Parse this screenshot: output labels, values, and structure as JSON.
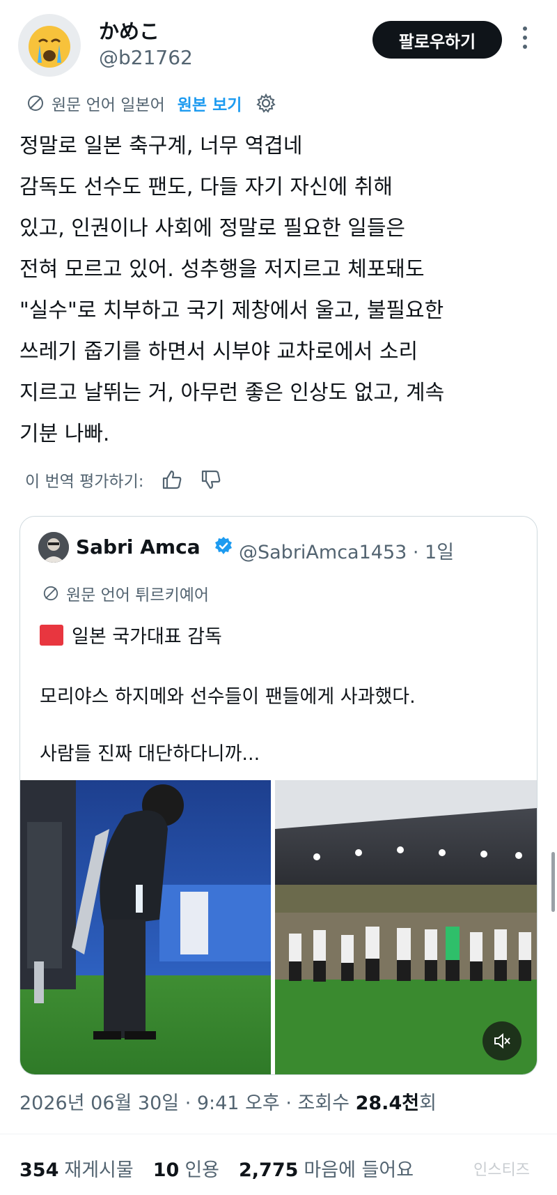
{
  "author": {
    "display_name": "かめこ",
    "handle": "@b21762",
    "avatar_icon": "crying-face-emoji-icon"
  },
  "follow_button": "팔로우하기",
  "translation": {
    "label": "원문 언어 일본어",
    "show_original": "원본 보기"
  },
  "body_lines": [
    "정말로 일본 축구계, 너무 역겹네",
    "감독도 선수도 팬도, 다들 자기 자신에 취해",
    "있고, 인권이나 사회에 정말로 필요한 일들은",
    "전혀 모르고 있어. 성추행을 저지르고 체포돼도",
    "\"실수\"로 치부하고 국기 제창에서 울고, 불필요한",
    "쓰레기 줍기를 하면서 시부야 교차로에서 소리",
    "지르고 날뛰는 거, 아무런 좋은 인상도 없고, 계속",
    "기분 나빠."
  ],
  "rate_translation": "이 번역 평가하기:",
  "quote": {
    "name": "Sabri Amca",
    "handle_time": "@SabriAmca1453 · 1일",
    "translation_label": "원문 언어 튀르키예어",
    "line1": "일본 국가대표 감독",
    "line2": "모리야스 하지메와 선수들이 팬들에게 사과했다.",
    "line3": "사람들 진짜 대단하다니까..."
  },
  "meta": {
    "date": "2026년 06월 30일 · 9:41 오후 · 조회수 ",
    "views": "28.4천",
    "views_suffix": "회"
  },
  "stats": {
    "reposts": "354",
    "reposts_label": "재게시물",
    "quotes": "10",
    "quotes_label": "인용",
    "likes": "2,775",
    "likes_label": "마음에 들어요"
  },
  "watermark": "인스티즈",
  "colors": {
    "accent": "#1d9bf0",
    "text": "#0f1419",
    "muted": "#536471"
  }
}
